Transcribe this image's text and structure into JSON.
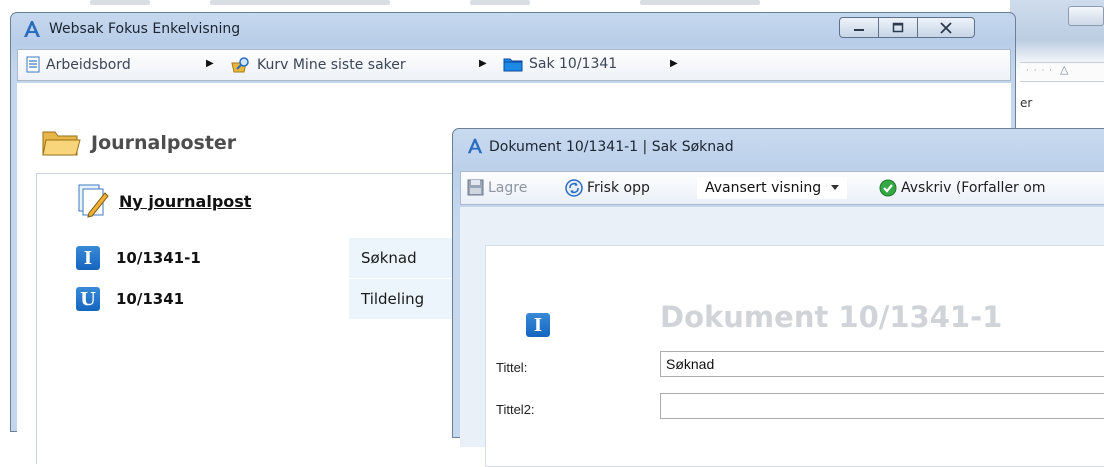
{
  "main_window": {
    "title": "Websak Fokus Enkelvisning",
    "breadcrumb": [
      {
        "label": "Arbeidsbord",
        "icon": "document-icon"
      },
      {
        "label": "Kurv Mine siste saker",
        "icon": "basket-search-icon"
      },
      {
        "label": "Sak 10/1341",
        "icon": "blue-folder-icon"
      }
    ],
    "section_title": "Journalposter",
    "new_post_label": "Ny journalpost",
    "rows": [
      {
        "badge": "I",
        "number": "10/1341-1",
        "title": "Søknad"
      },
      {
        "badge": "U",
        "number": "10/1341",
        "title": "Tildeling"
      }
    ]
  },
  "doc_window": {
    "title": "Dokument 10/1341-1 | Sak Søknad",
    "toolbar": {
      "save_label": "Lagre",
      "refresh_label": "Frisk opp",
      "view_select_value": "Avansert visning",
      "approve_label": "Avskriv (Forfaller om"
    },
    "badge": "I",
    "heading": "Dokument 10/1341-1",
    "fields": [
      {
        "label": "Tittel:",
        "value": "Søknad"
      },
      {
        "label": "Tittel2:",
        "value": ""
      }
    ]
  },
  "background_app": {
    "visible_text": "er"
  },
  "colors": {
    "window_frame": "#b8cde8",
    "badge_blue": "#1565c0",
    "row_highlight": "#edf5fc",
    "heading_grey": "#d0d3d8"
  }
}
